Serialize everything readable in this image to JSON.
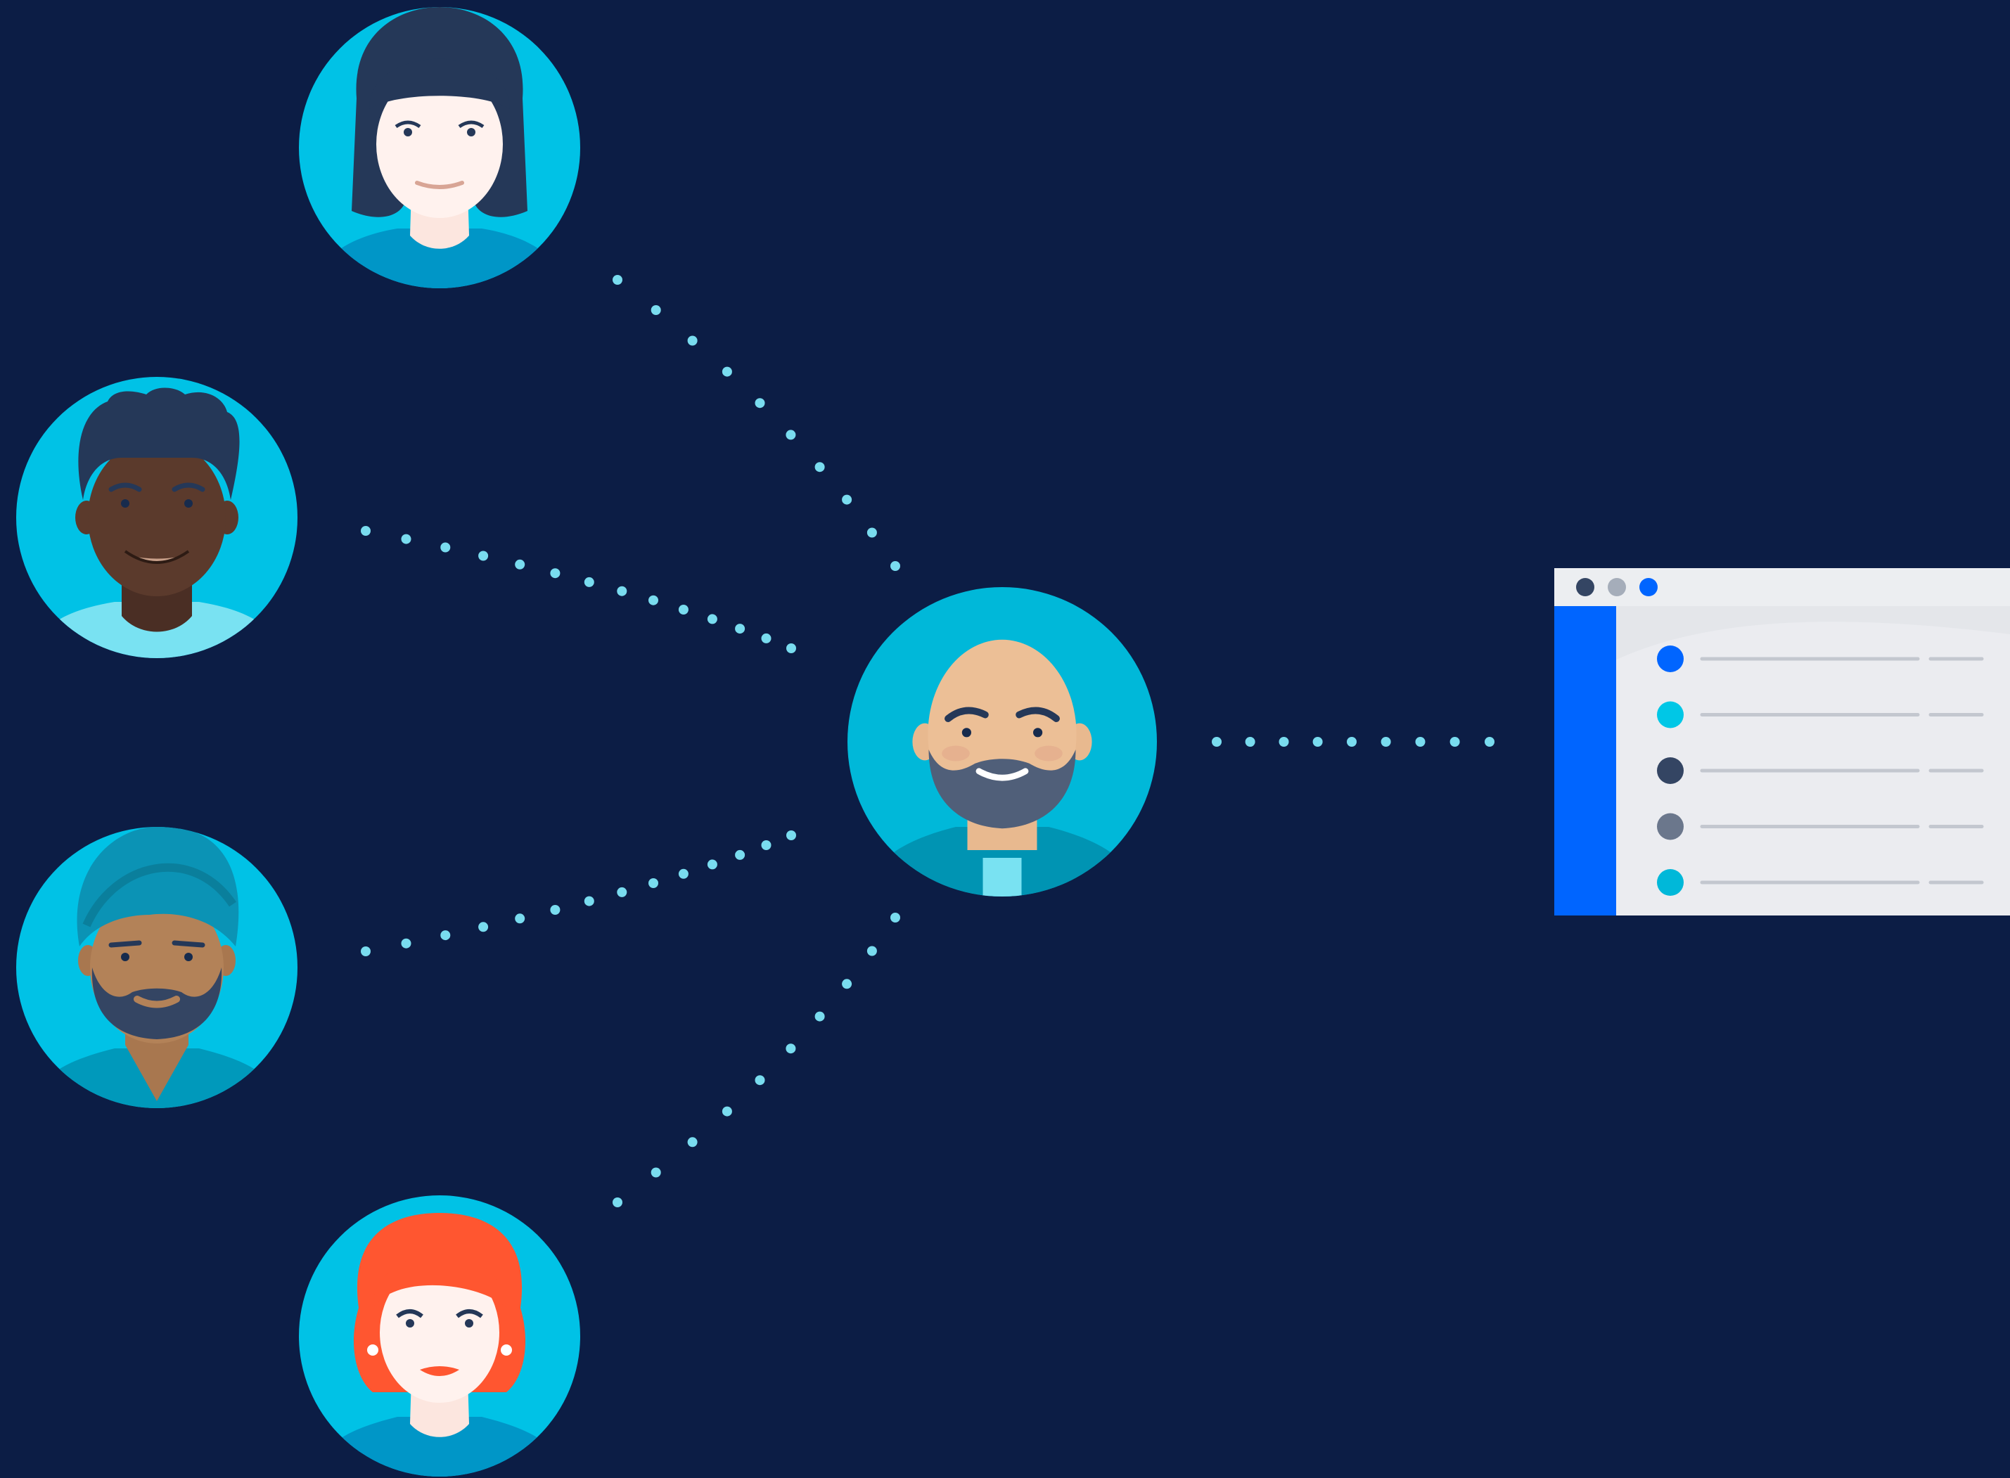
{
  "colors": {
    "background": "#0c1d45",
    "avatar_circle": "#00c2e6",
    "connector_dots": "#79dcef",
    "window_sidebar": "#0065ff",
    "window_titlebar": "#eceef1",
    "window_body": "#e4e6ea",
    "list_line": "#c3c7cf"
  },
  "icons": {
    "contributors": [
      "woman-dark-hair-avatar-icon",
      "man-curly-hair-avatar-icon",
      "man-turban-beard-avatar-icon",
      "woman-red-hair-avatar-icon"
    ],
    "hub": "bald-bearded-man-avatar-icon",
    "target": "app-window-icon"
  },
  "window": {
    "titlebar_dot_colors": [
      "#344563",
      "#a5adba",
      "#0065ff"
    ],
    "list_dot_colors": [
      "#0065ff",
      "#00c7e6",
      "#344563",
      "#6b778c",
      "#00b8d9"
    ]
  }
}
